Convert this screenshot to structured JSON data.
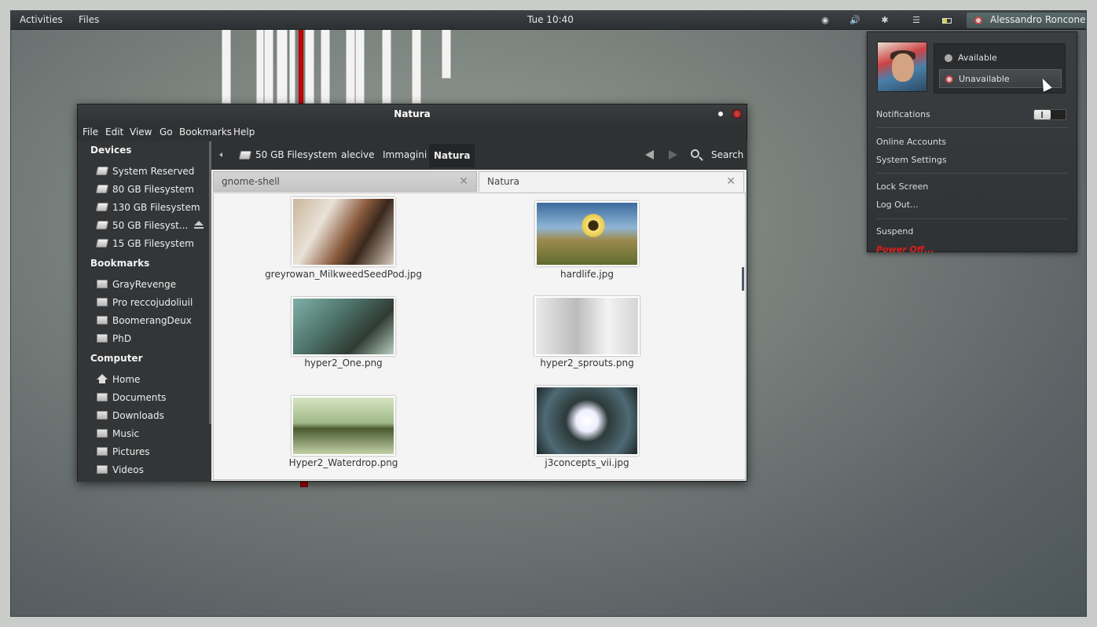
{
  "topbar": {
    "activities": "Activities",
    "files": "Files",
    "clock": "Tue 10:40",
    "user": "Alessandro Roncone",
    "icons": [
      "accessibility-icon",
      "volume-icon",
      "bluetooth-icon",
      "wifi-icon",
      "battery-icon"
    ]
  },
  "usermenu": {
    "status_available": "Available",
    "status_unavailable": "Unavailable",
    "notifications": "Notifications",
    "online_accounts": "Online Accounts",
    "system_settings": "System Settings",
    "lock_screen": "Lock Screen",
    "log_out": "Log Out...",
    "suspend": "Suspend",
    "power_off": "Power Off..."
  },
  "window": {
    "title": "Natura",
    "menu": [
      "File",
      "Edit",
      "View",
      "Go",
      "Bookmarks",
      "Help"
    ],
    "sidebar": {
      "devices_heading": "Devices",
      "devices": [
        "System Reserved",
        "80 GB Filesystem",
        "130 GB Filesystem",
        "50 GB Filesyst...",
        "15 GB Filesystem"
      ],
      "bookmarks_heading": "Bookmarks",
      "bookmarks": [
        "GrayRevenge",
        "Pro reccojudoliuil",
        "BoomerangDeux",
        "PhD"
      ],
      "computer_heading": "Computer",
      "computer": [
        "Home",
        "Documents",
        "Downloads",
        "Music",
        "Pictures",
        "Videos"
      ]
    },
    "path": [
      "50 GB Filesystem",
      "alecive",
      "Immagini",
      "Natura"
    ],
    "search_label": "Search",
    "tabs": [
      "gnome-shell",
      "Natura"
    ],
    "files": [
      "greyrowan_MilkweedSeedPod.jpg",
      "hardlife.jpg",
      "hyper2_One.png",
      "hyper2_sprouts.png",
      "Hyper2_Waterdrop.png",
      "j3concepts_vii.jpg"
    ]
  },
  "colors": {
    "accent_red": "#e01b1b",
    "panel_dark": "#2f3133"
  }
}
